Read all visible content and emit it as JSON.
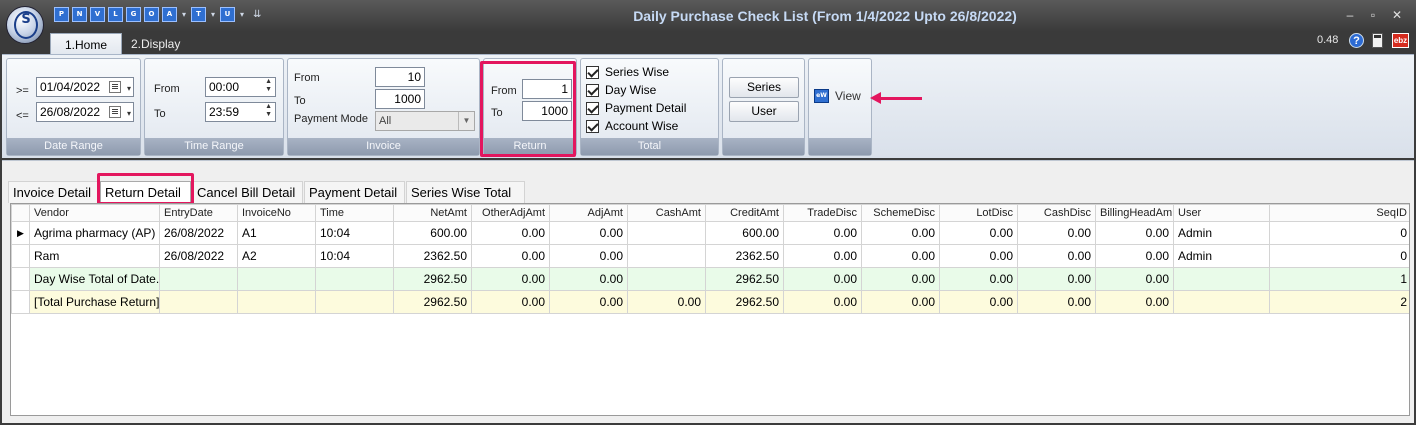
{
  "window": {
    "title": "Daily Purchase Check List (From 1/4/2022 Upto 26/8/2022)",
    "logo_text": "S",
    "quick_access": [
      "P",
      "N",
      "V",
      "L",
      "G",
      "O",
      "A",
      "T",
      "U"
    ],
    "controls": {
      "minimize": "–",
      "restore": "▫",
      "close": "✕"
    }
  },
  "ribbon_tabs": [
    "1.Home",
    "2.Display"
  ],
  "top_right": {
    "version": "0.48",
    "help": "?",
    "ebiz": "ebz"
  },
  "date_range": {
    "caption": "Date Range",
    "from_op": ">=",
    "from_value": "01/04/2022",
    "to_op": "<=",
    "to_value": "26/08/2022"
  },
  "time_range": {
    "caption": "Time Range",
    "from_label": "From",
    "from_value": "00:00",
    "to_label": "To",
    "to_value": "23:59"
  },
  "invoice": {
    "caption": "Invoice",
    "from_label": "From",
    "from_value": "10",
    "to_label": "To",
    "to_value": "1000",
    "mode_label": "Payment Mode",
    "mode_value": "All"
  },
  "return": {
    "caption": "Return",
    "from_label": "From",
    "from_value": "1",
    "to_label": "To",
    "to_value": "1000"
  },
  "total": {
    "caption": "Total",
    "options": [
      {
        "label": "Series Wise",
        "checked": true
      },
      {
        "label": "Day Wise",
        "checked": true
      },
      {
        "label": "Payment Detail",
        "checked": true
      },
      {
        "label": "Account Wise",
        "checked": true
      }
    ]
  },
  "buttons": {
    "series": "Series",
    "user": "User",
    "view": "View",
    "view_icon": "view-icon"
  },
  "content_tabs": [
    "Invoice Detail",
    "Return Detail",
    "Cancel Bill Detail",
    "Payment Detail",
    "Series Wise Total"
  ],
  "active_content_tab": "Return Detail",
  "grid": {
    "columns": [
      "Vendor",
      "EntryDate",
      "InvoiceNo",
      "Time",
      "NetAmt",
      "OtherAdjAmt",
      "AdjAmt",
      "CashAmt",
      "CreditAmt",
      "TradeDisc",
      "SchemeDisc",
      "LotDisc",
      "CashDisc",
      "BillingHeadAm",
      "User",
      "SeqID"
    ],
    "current_row_marker": "▶",
    "rows": [
      [
        "Agrima pharmacy (AP)",
        "26/08/2022",
        "A1",
        "10:04",
        "600.00",
        "0.00",
        "0.00",
        "",
        "600.00",
        "0.00",
        "0.00",
        "0.00",
        "0.00",
        "0.00",
        "Admin",
        "0"
      ],
      [
        "Ram",
        "26/08/2022",
        "A2",
        "10:04",
        "2362.50",
        "0.00",
        "0.00",
        "",
        "2362.50",
        "0.00",
        "0.00",
        "0.00",
        "0.00",
        "0.00",
        "Admin",
        "0"
      ],
      [
        "Day Wise Total of Date...",
        "",
        "",
        "",
        "2962.50",
        "0.00",
        "0.00",
        "",
        "2962.50",
        "0.00",
        "0.00",
        "0.00",
        "0.00",
        "0.00",
        "",
        "1"
      ],
      [
        "[Total Purchase Return]",
        "",
        "",
        "",
        "2962.50",
        "0.00",
        "0.00",
        "0.00",
        "2962.50",
        "0.00",
        "0.00",
        "0.00",
        "0.00",
        "0.00",
        "",
        "2"
      ]
    ]
  },
  "colors": {
    "highlight": "#e3165e",
    "title_text": "#c6daf5",
    "day_total_row": "#e9fbe9",
    "grand_total_row": "#fdfbdd"
  }
}
